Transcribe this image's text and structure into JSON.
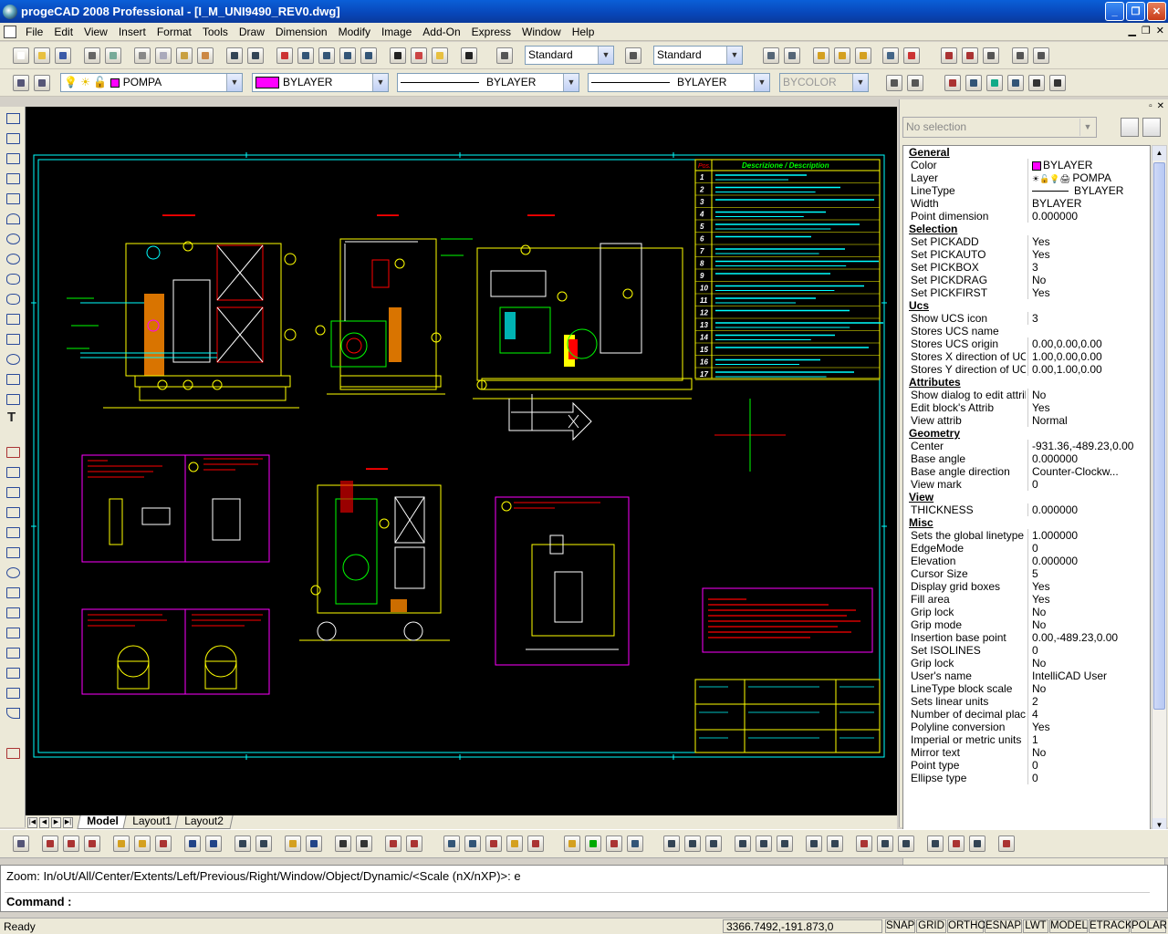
{
  "window": {
    "title": "progeCAD 2008 Professional - [I_M_UNI9490_REV0.dwg]"
  },
  "menu": [
    "File",
    "Edit",
    "View",
    "Insert",
    "Format",
    "Tools",
    "Draw",
    "Dimension",
    "Modify",
    "Image",
    "Add-On",
    "Express",
    "Window",
    "Help"
  ],
  "toolbar1": {
    "text_style": "Standard",
    "dim_style": "Standard"
  },
  "toolbar2": {
    "layer": "POMPA",
    "color": "BYLAYER",
    "linetype": "BYLAYER",
    "lineweight": "BYLAYER",
    "plotstyle": "BYCOLOR",
    "color_hex": "#ff00ff"
  },
  "tabs": {
    "model": "Model",
    "layout1": "Layout1",
    "layout2": "Layout2"
  },
  "props": {
    "selection_combo": "No selection",
    "rows": [
      {
        "cat": "General"
      },
      {
        "k": "Color",
        "v": "BYLAYER"
      },
      {
        "k": "Layer",
        "v": "POMPA"
      },
      {
        "k": "LineType",
        "v": "BYLAYER"
      },
      {
        "k": "Width",
        "v": "BYLAYER"
      },
      {
        "k": "Point dimension",
        "v": "0.000000"
      },
      {
        "cat": "Selection"
      },
      {
        "k": "Set PICKADD",
        "v": "Yes"
      },
      {
        "k": "Set PICKAUTO",
        "v": "Yes"
      },
      {
        "k": "Set PICKBOX",
        "v": "3"
      },
      {
        "k": "Set PICKDRAG",
        "v": "No"
      },
      {
        "k": "Set PICKFIRST",
        "v": "Yes"
      },
      {
        "cat": "Ucs"
      },
      {
        "k": "Show UCS icon",
        "v": "3"
      },
      {
        "k": "Stores UCS name",
        "v": ""
      },
      {
        "k": "Stores UCS origin",
        "v": "0.00,0.00,0.00"
      },
      {
        "k": "Stores X direction of UCS",
        "v": "1.00,0.00,0.00"
      },
      {
        "k": "Stores Y direction of UCS",
        "v": "0.00,1.00,0.00"
      },
      {
        "cat": "Attributes"
      },
      {
        "k": "Show dialog to edit attrib",
        "v": "No"
      },
      {
        "k": "Edit block's Attrib",
        "v": "Yes"
      },
      {
        "k": "View attrib",
        "v": "Normal"
      },
      {
        "cat": "Geometry"
      },
      {
        "k": "Center",
        "v": "-931.36,-489.23,0.00"
      },
      {
        "k": "Base angle",
        "v": "0.000000"
      },
      {
        "k": "Base angle direction",
        "v": "Counter-Clockw..."
      },
      {
        "k": "View mark",
        "v": "0"
      },
      {
        "cat": "View"
      },
      {
        "k": "THICKNESS",
        "v": "0.000000"
      },
      {
        "cat": "Misc"
      },
      {
        "k": "Sets the global linetype ...",
        "v": "1.000000"
      },
      {
        "k": "EdgeMode",
        "v": "0"
      },
      {
        "k": "Elevation",
        "v": "0.000000"
      },
      {
        "k": "Cursor Size",
        "v": "5"
      },
      {
        "k": "Display grid boxes",
        "v": "Yes"
      },
      {
        "k": "Fill area",
        "v": "Yes"
      },
      {
        "k": "Grip lock",
        "v": "No"
      },
      {
        "k": "Grip mode",
        "v": "No"
      },
      {
        "k": "Insertion base point",
        "v": "0.00,-489.23,0.00"
      },
      {
        "k": "Set ISOLINES",
        "v": "0"
      },
      {
        "k": "Grip lock",
        "v": "No"
      },
      {
        "k": "User's name",
        "v": "IntelliCAD User"
      },
      {
        "k": "LineType block scale",
        "v": "No"
      },
      {
        "k": "Sets linear units",
        "v": "2"
      },
      {
        "k": "Number of decimal places",
        "v": "4"
      },
      {
        "k": "Polyline conversion",
        "v": "Yes"
      },
      {
        "k": "Imperial or metric units",
        "v": "1"
      },
      {
        "k": "Mirror text",
        "v": "No"
      },
      {
        "k": "Point type",
        "v": "0"
      },
      {
        "k": "Ellipse type",
        "v": "0"
      }
    ]
  },
  "drawing": {
    "table_header_pos": "Pos.",
    "table_header_desc": "Descrizione / Description",
    "positions": [
      "1",
      "2",
      "3",
      "4",
      "5",
      "6",
      "7",
      "8",
      "9",
      "10",
      "11",
      "12",
      "13",
      "14",
      "15",
      "16",
      "17"
    ]
  },
  "command": {
    "history": "Zoom:  In/oUt/All/Center/Extents/Left/Previous/Right/Window/Object/Dynamic/<Scale (nX/nXP)>: e",
    "prompt": "Command :"
  },
  "status": {
    "ready": "Ready",
    "coords": "3366.7492,-191.873,0",
    "buttons": [
      "SNAP",
      "GRID",
      "ORTHO",
      "ESNAP",
      "LWT",
      "MODEL",
      "ETRACK",
      "POLAR"
    ]
  }
}
